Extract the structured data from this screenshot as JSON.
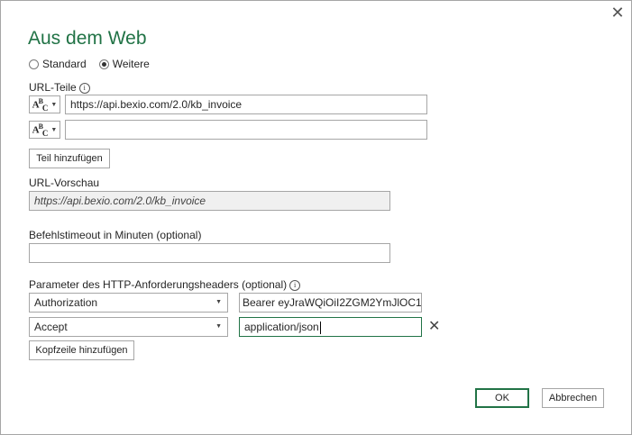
{
  "dialog": {
    "title": "Aus dem Web",
    "close_glyph": "✕"
  },
  "mode": {
    "options": [
      {
        "label": "Standard",
        "checked": false
      },
      {
        "label": "Weitere",
        "checked": true
      }
    ]
  },
  "url_parts": {
    "label": "URL-Teile",
    "info_glyph": "i",
    "type_glyph": "ABC",
    "rows": [
      {
        "value": "https://api.bexio.com/2.0/kb_invoice"
      },
      {
        "value": ""
      }
    ],
    "add_button": "Teil hinzufügen"
  },
  "preview": {
    "label": "URL-Vorschau",
    "value": "https://api.bexio.com/2.0/kb_invoice"
  },
  "timeout": {
    "label": "Befehlstimeout in Minuten (optional)",
    "value": ""
  },
  "headers": {
    "label": "Parameter des HTTP-Anforderungsheaders (optional)",
    "info_glyph": "i",
    "rows": [
      {
        "name": "Authorization",
        "value": "Bearer eyJraWQiOiI2ZGM2YmJlOC1iM"
      },
      {
        "name": "Accept",
        "value": "application/json"
      }
    ],
    "add_button": "Kopfzeile hinzufügen",
    "remove_glyph": "✕"
  },
  "footer": {
    "ok_label": "OK",
    "cancel_label": "Abbrechen"
  },
  "colors": {
    "accent": "#217346",
    "border": "#a6a6a6"
  }
}
